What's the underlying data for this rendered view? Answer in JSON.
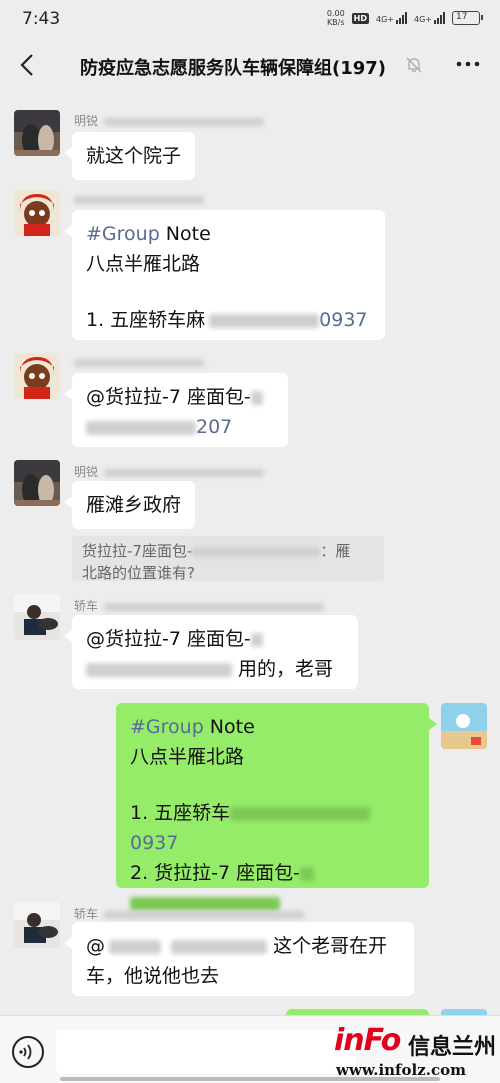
{
  "status_bar": {
    "time": "7:43",
    "net_speed": "0.00",
    "net_unit": "KB/s",
    "hd": "HD",
    "sim1": "4G+",
    "sim2": "4G+",
    "battery": "17"
  },
  "header": {
    "title": "防疫应急志愿服务队车辆保障组(197)"
  },
  "messages": [
    {
      "sender": "明锐",
      "text": "就这个院子"
    },
    {
      "note_hash": "#Group",
      "note_word": " Note",
      "line1": "八点半雁北路",
      "item1": "1. 五座轿车麻",
      "item1_num": "0937"
    },
    {
      "mention": "@货拉拉-7 座面包-",
      "num_tail": "207"
    },
    {
      "sender": "明锐",
      "text": "雁滩乡政府",
      "quote_prefix": "货拉拉-7座面包-",
      "quote_suffix": "：雁",
      "quote_line2": "北路的位置谁有?"
    },
    {
      "sender": "轿车",
      "mention": "@货拉拉-7 座面包-",
      "tail": "用的，老哥"
    },
    {
      "note_hash": "#Group",
      "note_word": " Note",
      "line1": "八点半雁北路",
      "item1": "1. 五座轿车",
      "item1_num": "0937",
      "item2": "2. 货拉拉-7 座面包-"
    },
    {
      "sender": "轿车",
      "prefix": "@",
      "line1_tail": "这个老哥在开",
      "line2": "车，他说他也去"
    }
  ],
  "watermark": {
    "brand": "inFo",
    "cn": "信息兰州",
    "url": "www.infolz.com"
  },
  "colors": {
    "bubble_green": "#95ec69",
    "link_blue": "#576b95",
    "background": "#ededed",
    "brand_red": "#e2001a"
  }
}
